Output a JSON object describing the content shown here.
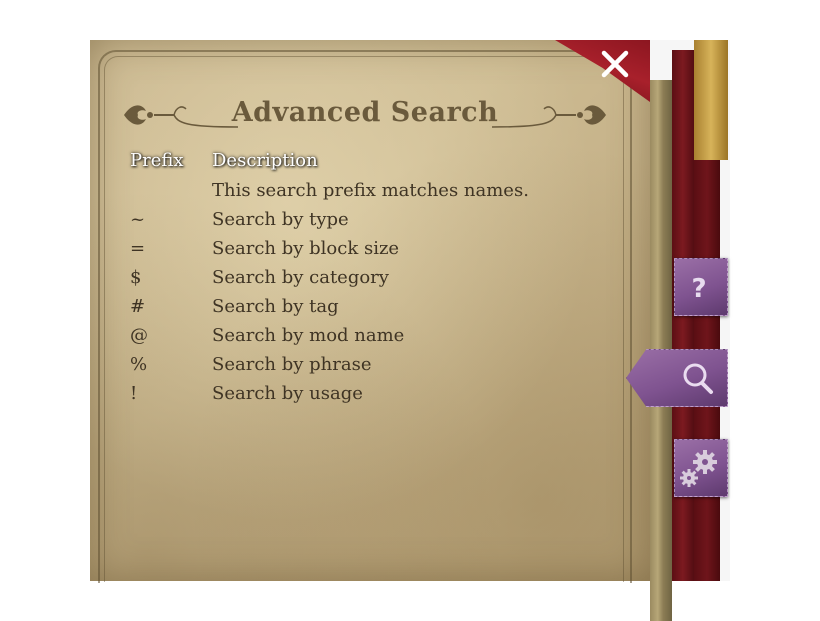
{
  "window": {
    "title": "Advanced Search",
    "close_label": "Close"
  },
  "table": {
    "headers": {
      "prefix": "Prefix",
      "description": "Description"
    },
    "rows": [
      {
        "prefix": "",
        "description": "This search prefix matches names."
      },
      {
        "prefix": "~",
        "description": "Search by type"
      },
      {
        "prefix": "=",
        "description": "Search by block size"
      },
      {
        "prefix": "$",
        "description": "Search by category"
      },
      {
        "prefix": "#",
        "description": "Search by tag"
      },
      {
        "prefix": "@",
        "description": "Search by mod name"
      },
      {
        "prefix": "%",
        "description": "Search by phrase"
      },
      {
        "prefix": "!",
        "description": "Search by usage"
      }
    ]
  },
  "side_tabs": [
    {
      "icon": "question-mark-icon"
    },
    {
      "icon": "magnifier-icon",
      "selected": true
    },
    {
      "icon": "gears-icon"
    }
  ],
  "colors": {
    "parchment": "#c7b48c",
    "title_text": "#6a5a3c",
    "body_text": "#3f3424",
    "spine_red": "#7c1a20",
    "tab_purple": "#8a5d9a",
    "gold": "#d7b35a"
  }
}
